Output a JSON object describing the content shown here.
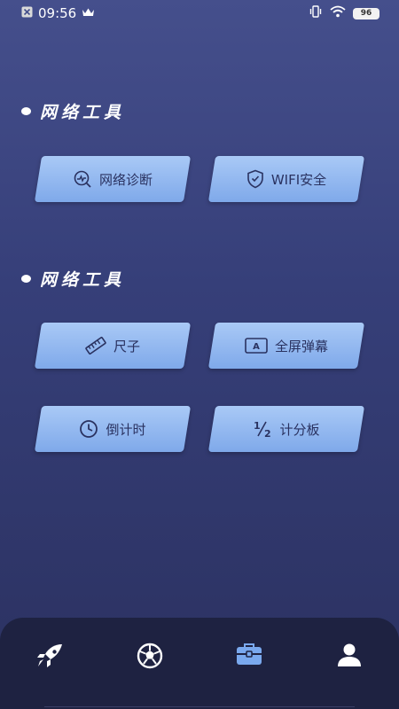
{
  "status_bar": {
    "time": "09:56",
    "battery": "96"
  },
  "sections": [
    {
      "title": "网络工具"
    },
    {
      "title": "网络工具"
    }
  ],
  "tools": {
    "network_diagnosis": {
      "label": "网络诊断",
      "icon": "network-diagnosis-icon"
    },
    "wifi_security": {
      "label": "WIFI安全",
      "icon": "shield-icon"
    },
    "ruler": {
      "label": "尺子",
      "icon": "ruler-icon"
    },
    "fullscreen_barrage": {
      "label": "全屏弹幕",
      "icon": "barrage-icon"
    },
    "countdown": {
      "label": "倒计时",
      "icon": "clock-icon"
    },
    "scoreboard": {
      "label": "计分板",
      "icon": "half-icon"
    }
  },
  "nav": [
    {
      "icon": "rocket-icon",
      "active": false
    },
    {
      "icon": "soccer-ball-icon",
      "active": false
    },
    {
      "icon": "toolbox-icon",
      "active": true
    },
    {
      "icon": "person-icon",
      "active": false
    }
  ],
  "colors": {
    "button_top": "#a9c9f6",
    "button_bottom": "#7fa9ea",
    "nav_active": "#7aa9ee",
    "nav_bg": "#1e2241"
  }
}
